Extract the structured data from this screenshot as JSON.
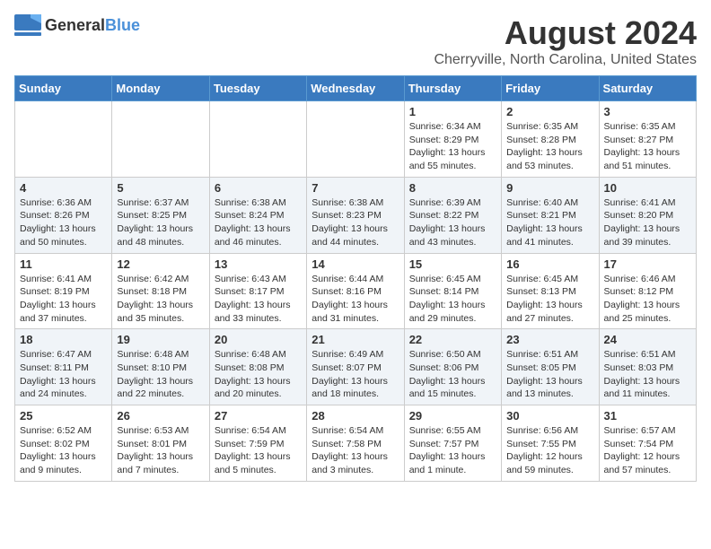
{
  "logo": {
    "text_general": "General",
    "text_blue": "Blue"
  },
  "header": {
    "month": "August 2024",
    "location": "Cherryville, North Carolina, United States"
  },
  "weekdays": [
    "Sunday",
    "Monday",
    "Tuesday",
    "Wednesday",
    "Thursday",
    "Friday",
    "Saturday"
  ],
  "weeks": [
    [
      {
        "day": "",
        "info": ""
      },
      {
        "day": "",
        "info": ""
      },
      {
        "day": "",
        "info": ""
      },
      {
        "day": "",
        "info": ""
      },
      {
        "day": "1",
        "info": "Sunrise: 6:34 AM\nSunset: 8:29 PM\nDaylight: 13 hours\nand 55 minutes."
      },
      {
        "day": "2",
        "info": "Sunrise: 6:35 AM\nSunset: 8:28 PM\nDaylight: 13 hours\nand 53 minutes."
      },
      {
        "day": "3",
        "info": "Sunrise: 6:35 AM\nSunset: 8:27 PM\nDaylight: 13 hours\nand 51 minutes."
      }
    ],
    [
      {
        "day": "4",
        "info": "Sunrise: 6:36 AM\nSunset: 8:26 PM\nDaylight: 13 hours\nand 50 minutes."
      },
      {
        "day": "5",
        "info": "Sunrise: 6:37 AM\nSunset: 8:25 PM\nDaylight: 13 hours\nand 48 minutes."
      },
      {
        "day": "6",
        "info": "Sunrise: 6:38 AM\nSunset: 8:24 PM\nDaylight: 13 hours\nand 46 minutes."
      },
      {
        "day": "7",
        "info": "Sunrise: 6:38 AM\nSunset: 8:23 PM\nDaylight: 13 hours\nand 44 minutes."
      },
      {
        "day": "8",
        "info": "Sunrise: 6:39 AM\nSunset: 8:22 PM\nDaylight: 13 hours\nand 43 minutes."
      },
      {
        "day": "9",
        "info": "Sunrise: 6:40 AM\nSunset: 8:21 PM\nDaylight: 13 hours\nand 41 minutes."
      },
      {
        "day": "10",
        "info": "Sunrise: 6:41 AM\nSunset: 8:20 PM\nDaylight: 13 hours\nand 39 minutes."
      }
    ],
    [
      {
        "day": "11",
        "info": "Sunrise: 6:41 AM\nSunset: 8:19 PM\nDaylight: 13 hours\nand 37 minutes."
      },
      {
        "day": "12",
        "info": "Sunrise: 6:42 AM\nSunset: 8:18 PM\nDaylight: 13 hours\nand 35 minutes."
      },
      {
        "day": "13",
        "info": "Sunrise: 6:43 AM\nSunset: 8:17 PM\nDaylight: 13 hours\nand 33 minutes."
      },
      {
        "day": "14",
        "info": "Sunrise: 6:44 AM\nSunset: 8:16 PM\nDaylight: 13 hours\nand 31 minutes."
      },
      {
        "day": "15",
        "info": "Sunrise: 6:45 AM\nSunset: 8:14 PM\nDaylight: 13 hours\nand 29 minutes."
      },
      {
        "day": "16",
        "info": "Sunrise: 6:45 AM\nSunset: 8:13 PM\nDaylight: 13 hours\nand 27 minutes."
      },
      {
        "day": "17",
        "info": "Sunrise: 6:46 AM\nSunset: 8:12 PM\nDaylight: 13 hours\nand 25 minutes."
      }
    ],
    [
      {
        "day": "18",
        "info": "Sunrise: 6:47 AM\nSunset: 8:11 PM\nDaylight: 13 hours\nand 24 minutes."
      },
      {
        "day": "19",
        "info": "Sunrise: 6:48 AM\nSunset: 8:10 PM\nDaylight: 13 hours\nand 22 minutes."
      },
      {
        "day": "20",
        "info": "Sunrise: 6:48 AM\nSunset: 8:08 PM\nDaylight: 13 hours\nand 20 minutes."
      },
      {
        "day": "21",
        "info": "Sunrise: 6:49 AM\nSunset: 8:07 PM\nDaylight: 13 hours\nand 18 minutes."
      },
      {
        "day": "22",
        "info": "Sunrise: 6:50 AM\nSunset: 8:06 PM\nDaylight: 13 hours\nand 15 minutes."
      },
      {
        "day": "23",
        "info": "Sunrise: 6:51 AM\nSunset: 8:05 PM\nDaylight: 13 hours\nand 13 minutes."
      },
      {
        "day": "24",
        "info": "Sunrise: 6:51 AM\nSunset: 8:03 PM\nDaylight: 13 hours\nand 11 minutes."
      }
    ],
    [
      {
        "day": "25",
        "info": "Sunrise: 6:52 AM\nSunset: 8:02 PM\nDaylight: 13 hours\nand 9 minutes."
      },
      {
        "day": "26",
        "info": "Sunrise: 6:53 AM\nSunset: 8:01 PM\nDaylight: 13 hours\nand 7 minutes."
      },
      {
        "day": "27",
        "info": "Sunrise: 6:54 AM\nSunset: 7:59 PM\nDaylight: 13 hours\nand 5 minutes."
      },
      {
        "day": "28",
        "info": "Sunrise: 6:54 AM\nSunset: 7:58 PM\nDaylight: 13 hours\nand 3 minutes."
      },
      {
        "day": "29",
        "info": "Sunrise: 6:55 AM\nSunset: 7:57 PM\nDaylight: 13 hours\nand 1 minute."
      },
      {
        "day": "30",
        "info": "Sunrise: 6:56 AM\nSunset: 7:55 PM\nDaylight: 12 hours\nand 59 minutes."
      },
      {
        "day": "31",
        "info": "Sunrise: 6:57 AM\nSunset: 7:54 PM\nDaylight: 12 hours\nand 57 minutes."
      }
    ]
  ]
}
